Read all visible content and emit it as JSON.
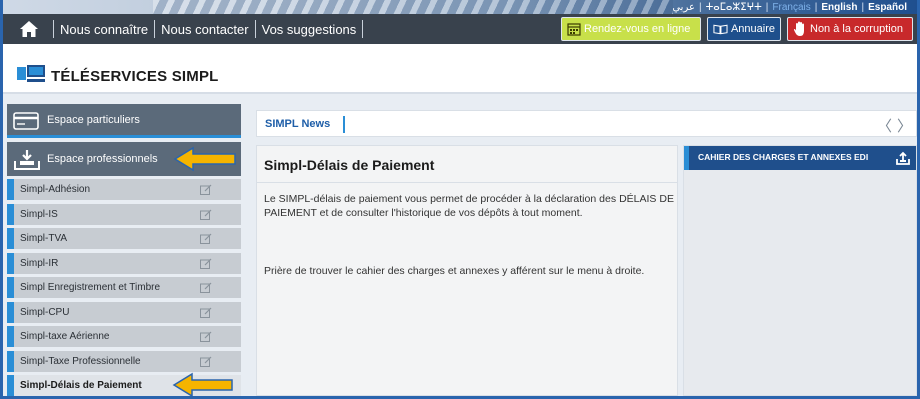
{
  "languages": {
    "arabic": "عربي",
    "tifinagh": "ⵜⴰⵎⴰⵣⵉⵖⵜ",
    "french": "Français",
    "english": "English",
    "spanish": "Español"
  },
  "nav": {
    "links": [
      "Nous connaître",
      "Nous contacter",
      "Vos suggestions"
    ],
    "buttons": {
      "rdv": "Rendez-vous en ligne",
      "annuaire": "Annuaire",
      "corruption": "Non à la corruption"
    }
  },
  "header": {
    "title": "TÉLÉSERVICES SIMPL"
  },
  "sidebar": {
    "particuliers": "Espace particuliers",
    "professionnels": "Espace professionnels",
    "items": [
      "Simpl-Adhésion",
      "Simpl-IS",
      "Simpl-TVA",
      "Simpl-IR",
      "Simpl Enregistrement et Timbre",
      "Simpl-CPU",
      "Simpl-taxe Aérienne",
      "Simpl-Taxe Professionnelle",
      "Simpl-Délais de Paiement"
    ]
  },
  "news": {
    "label": "SIMPL News",
    "prev": "〈",
    "next": "〉"
  },
  "content": {
    "title": "Simpl-Délais de Paiement",
    "p1": "Le SIMPL-délais de paiement vous permet de procéder à la déclaration des DÉLAIS DE PAIEMENT et de consulter l'historique de vos dépôts à tout moment.",
    "p2": "Prière de trouver le cahier des charges et annexes y afférent sur le menu à droite."
  },
  "right_panel": {
    "title": "CAHIER DES CHARGES ET ANNEXES EDI"
  },
  "colors": {
    "accent_blue": "#2a8ed6",
    "nav_dark": "#39424d",
    "rdv_green": "#c8e04a",
    "corruption_red": "#c8292b",
    "arrow_yellow": "#f5b400"
  }
}
